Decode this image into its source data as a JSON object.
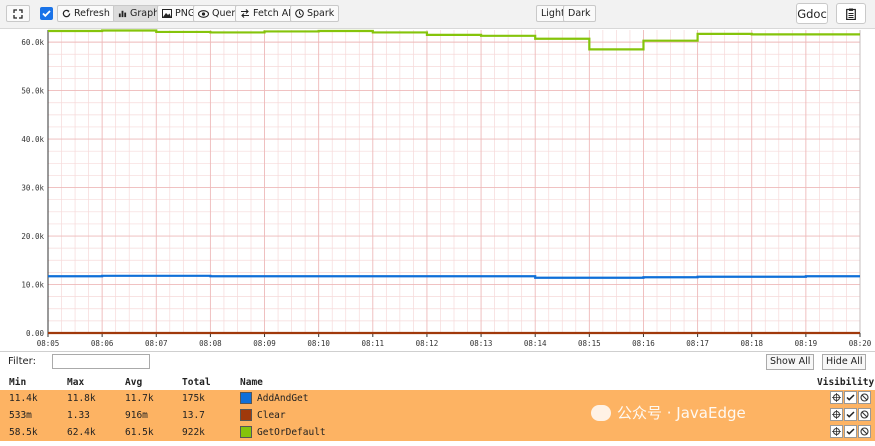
{
  "toolbar": {
    "refresh": "Refresh",
    "graph": "Graph",
    "png": "PNG",
    "query": "Query",
    "fetch_api": "Fetch API",
    "spark": "Spark",
    "light": "Light",
    "dark": "Dark",
    "gdoc": "Gdoc"
  },
  "filter": {
    "label": "Filter:",
    "value": "",
    "show_all": "Show All",
    "hide_all": "Hide All"
  },
  "legend": {
    "headers": [
      "Min",
      "Max",
      "Avg",
      "Total",
      "Name",
      "Visibility"
    ],
    "rows": [
      {
        "min": "11.4k",
        "max": "11.8k",
        "avg": "11.7k",
        "total": "175k",
        "name": "AddAndGet",
        "color": "#0f6fd8"
      },
      {
        "min": "533m",
        "max": "1.33",
        "avg": "916m",
        "total": "13.7",
        "name": "Clear",
        "color": "#a0390b"
      },
      {
        "min": "58.5k",
        "max": "62.4k",
        "avg": "61.5k",
        "total": "922k",
        "name": "GetOrDefault",
        "color": "#85c40b"
      }
    ]
  },
  "watermark": "公众号 · JavaEdge",
  "chart_data": {
    "type": "line",
    "x": [
      "08:05",
      "08:06",
      "08:07",
      "08:08",
      "08:09",
      "08:10",
      "08:11",
      "08:12",
      "08:13",
      "08:14",
      "08:15",
      "08:16",
      "08:17",
      "08:18",
      "08:19",
      "08:20"
    ],
    "y_ticks": [
      "0.00",
      "10.0k",
      "20.0k",
      "30.0k",
      "40.0k",
      "50.0k",
      "60.0k"
    ],
    "ylim": [
      0,
      62500
    ],
    "step": true,
    "series": [
      {
        "name": "GetOrDefault",
        "color": "#85c40b",
        "values": [
          62300,
          62400,
          62100,
          62000,
          62200,
          62300,
          62000,
          61500,
          61300,
          60700,
          58500,
          60300,
          61700,
          61600,
          61600,
          61600
        ]
      },
      {
        "name": "AddAndGet",
        "color": "#0f6fd8",
        "values": [
          11700,
          11800,
          11800,
          11700,
          11700,
          11700,
          11700,
          11700,
          11700,
          11400,
          11400,
          11500,
          11600,
          11600,
          11700,
          11700
        ]
      },
      {
        "name": "Clear",
        "color": "#a0390b",
        "values": [
          0.9,
          0.8,
          1.0,
          0.9,
          0.7,
          1.1,
          0.9,
          1.0,
          0.8,
          0.9,
          1.2,
          0.9,
          0.8,
          1.0,
          0.9,
          0.9
        ]
      }
    ]
  }
}
